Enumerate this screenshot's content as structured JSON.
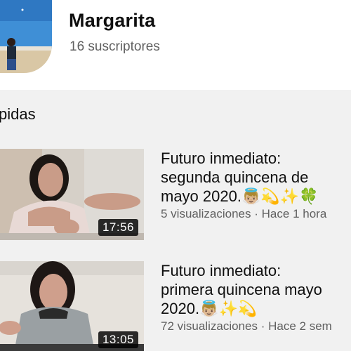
{
  "channel": {
    "name": "Margarita",
    "subscribers": "16 suscriptores"
  },
  "section": {
    "title": "pidas"
  },
  "videos": [
    {
      "title_lines": [
        "Futuro inmediato:",
        "segunda quincena de",
        "mayo 2020.👼🏼💫✨🍀"
      ],
      "views": "5 visualizaciones",
      "separator": "·",
      "age": "Hace 1 hora",
      "duration": "17:56"
    },
    {
      "title_lines": [
        "Futuro inmediato:",
        "primera quincena mayo",
        "2020.👼🏼✨💫"
      ],
      "views": "72 visualizaciones",
      "separator": "·",
      "age": "Hace 2 sem",
      "duration": "13:05"
    }
  ],
  "colors": {
    "header_bg": "#ffffff",
    "page_bg": "#f1f1f1",
    "primary_text": "#0f0f0f",
    "secondary_text": "#606060"
  }
}
